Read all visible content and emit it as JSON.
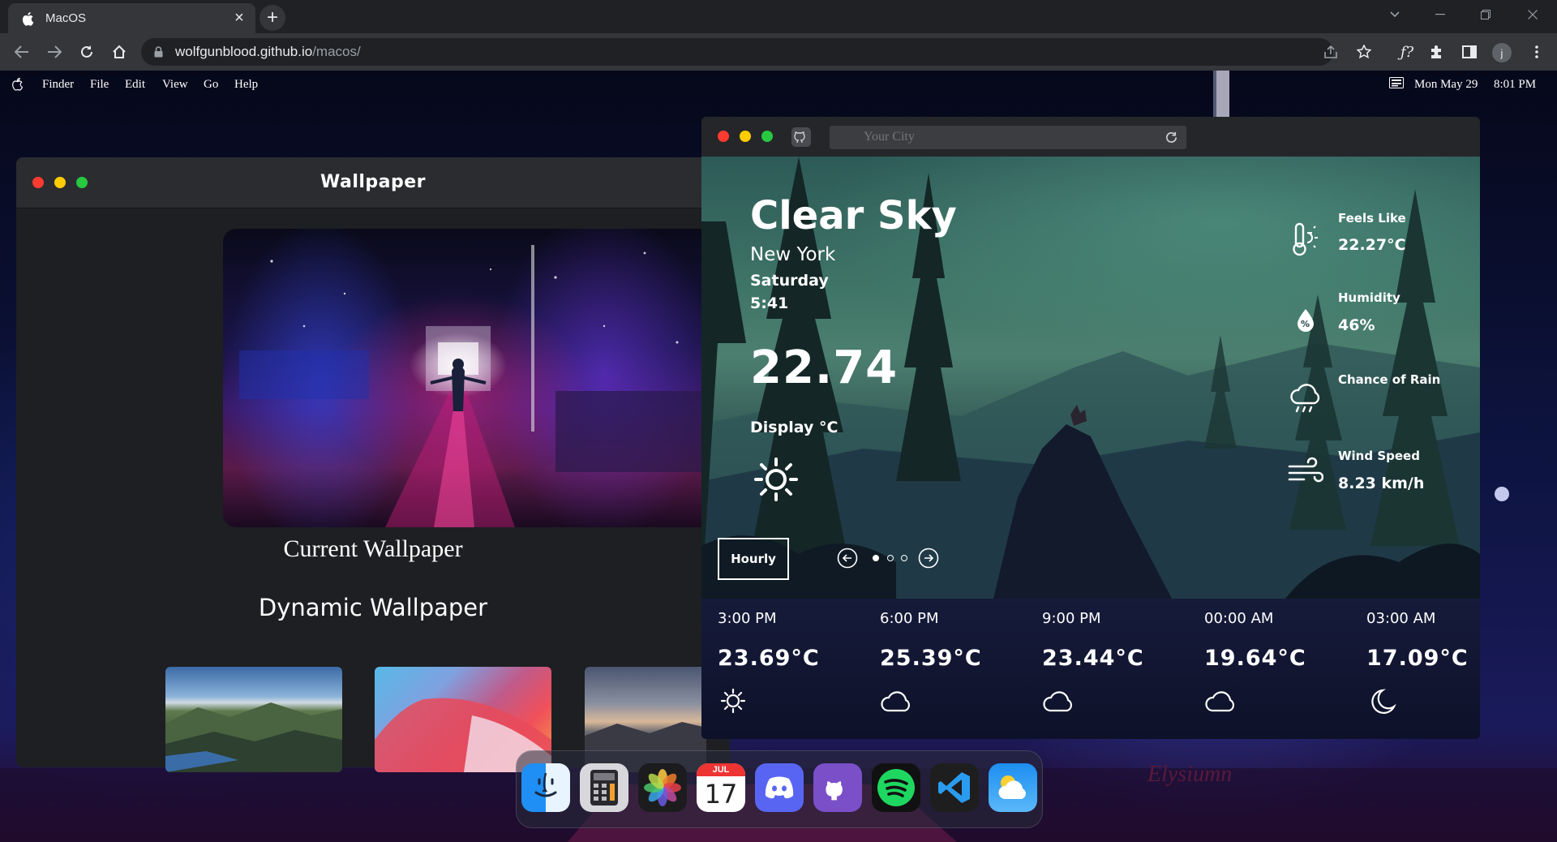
{
  "browser": {
    "tab_title": "MacOS",
    "url_host": "wolfgunblood.github.io",
    "url_path": "/macos/",
    "new_tab": "+",
    "close_tab": "×"
  },
  "menubar": {
    "items": [
      "Finder",
      "File",
      "Edit",
      "View",
      "Go",
      "Help"
    ],
    "date": "Mon May 29",
    "time": "8:01 PM"
  },
  "wallpaper_window": {
    "title": "Wallpaper",
    "current_label": "Current Wallpaper",
    "dynamic_label": "Dynamic Wallpaper"
  },
  "weather": {
    "search_placeholder": "Your City",
    "condition": "Clear Sky",
    "city": "New York",
    "day": "Saturday",
    "clock": "5:41",
    "temperature": "22.74",
    "display_unit": "Display °C",
    "feels_like_label": "Feels Like",
    "feels_like_value": "22.27°C",
    "humidity_label": "Humidity",
    "humidity_value": "46%",
    "rain_label": "Chance of Rain",
    "wind_label": "Wind Speed",
    "wind_value": "8.23 km/h",
    "hourly_button": "Hourly",
    "forecast": [
      {
        "time": "3:00 PM",
        "temp": "23.69°C",
        "icon": "sun-icon"
      },
      {
        "time": "6:00 PM",
        "temp": "25.39°C",
        "icon": "cloud-icon"
      },
      {
        "time": "9:00 PM",
        "temp": "23.44°C",
        "icon": "cloud-icon"
      },
      {
        "time": "00:00 AM",
        "temp": "19.64°C",
        "icon": "cloud-icon"
      },
      {
        "time": "03:00 AM",
        "temp": "17.09°C",
        "icon": "moon-icon"
      }
    ]
  },
  "dock": {
    "apps": [
      "finder-icon",
      "calculator-icon",
      "photos-icon",
      "calendar-icon",
      "discord-icon",
      "github-icon",
      "spotify-icon",
      "vscode-icon",
      "weather-icon"
    ],
    "calendar_month": "JUL",
    "calendar_day": "17"
  },
  "colors": {
    "traffic_red": "#ff3b30",
    "traffic_yellow": "#ffcc00",
    "traffic_green": "#28c840",
    "chrome_dark": "#202124",
    "chrome_toolbar": "#35363a"
  }
}
